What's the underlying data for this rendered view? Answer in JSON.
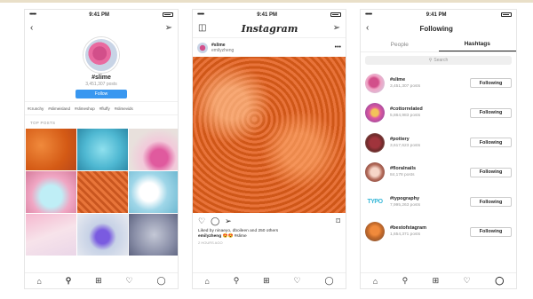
{
  "status": {
    "time": "9:41 PM",
    "signal": "•••••"
  },
  "screen1": {
    "hashtag": "#slime",
    "post_count": "3,451,307 posts",
    "follow_label": "Follow",
    "related": [
      "#crunchy",
      "#slimeisland",
      "#slimeshop",
      "#fluffy",
      "#slimevids"
    ],
    "section_label": "TOP POSTS"
  },
  "screen2": {
    "logo": "Instagram",
    "post_user": "#slime",
    "post_sub": "emilyzheng",
    "likes": "Liked by ninaeyo, dboileen and 250 others",
    "caption_user": "emilyzheng",
    "caption_text": "😍😍 #slime",
    "ago": "2 HOURS AGO"
  },
  "screen3": {
    "title": "Following",
    "tab_people": "People",
    "tab_hashtags": "Hashtags",
    "search_placeholder": "Search",
    "hashtags": [
      {
        "name": "#slime",
        "count": "3,451,307 posts",
        "button": "Following"
      },
      {
        "name": "#cottorrelated",
        "count": "5,864,983 posts",
        "button": "Following"
      },
      {
        "name": "#pottery",
        "count": "3,617,623 posts",
        "button": "Following"
      },
      {
        "name": "#floralnails",
        "count": "84,178 posts",
        "button": "Following"
      },
      {
        "name": "#typography",
        "count": "7,995,263 posts",
        "button": "Following"
      },
      {
        "name": "#bestofstagram",
        "count": "1,654,371 posts",
        "button": "Following"
      }
    ],
    "typo_thumb_text": "TYPO"
  },
  "icons": {
    "back": "‹",
    "send": "➢",
    "camera": "◫",
    "more": "•••",
    "heart": "♡",
    "comment": "◯",
    "share": "➢",
    "bookmark": "⌑",
    "home": "⌂",
    "search": "⚲",
    "add": "⊞",
    "activity": "♡",
    "profile": "◯"
  }
}
